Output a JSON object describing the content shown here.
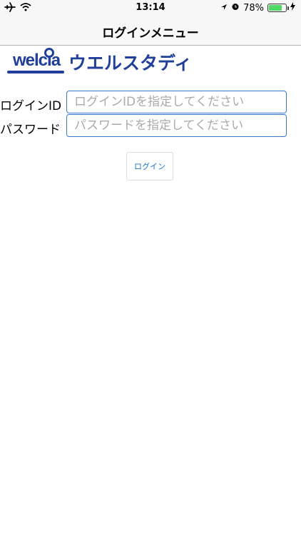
{
  "status_bar": {
    "time": "13:14",
    "battery_percent_label": "78%",
    "battery_level": 0.78,
    "icons": [
      "airplane-icon",
      "wifi-icon",
      "location-arrow-icon",
      "alarm-icon",
      "battery-icon",
      "charging-bolt-icon"
    ]
  },
  "nav": {
    "title": "ログインメニュー"
  },
  "logo": {
    "brand": "welcia",
    "service": "ウエルスタディ"
  },
  "form": {
    "login_id": {
      "label": "ログインID",
      "value": "",
      "placeholder": "ログインIDを指定してください"
    },
    "password": {
      "label": "パスワード",
      "value": "",
      "placeholder": "パスワードを指定してください"
    },
    "submit_label": "ログイン"
  },
  "colors": {
    "accent": "#3a78c9",
    "brand": "#1f3f9a",
    "button_text": "#1a73c9",
    "battery": "#4cd964"
  }
}
